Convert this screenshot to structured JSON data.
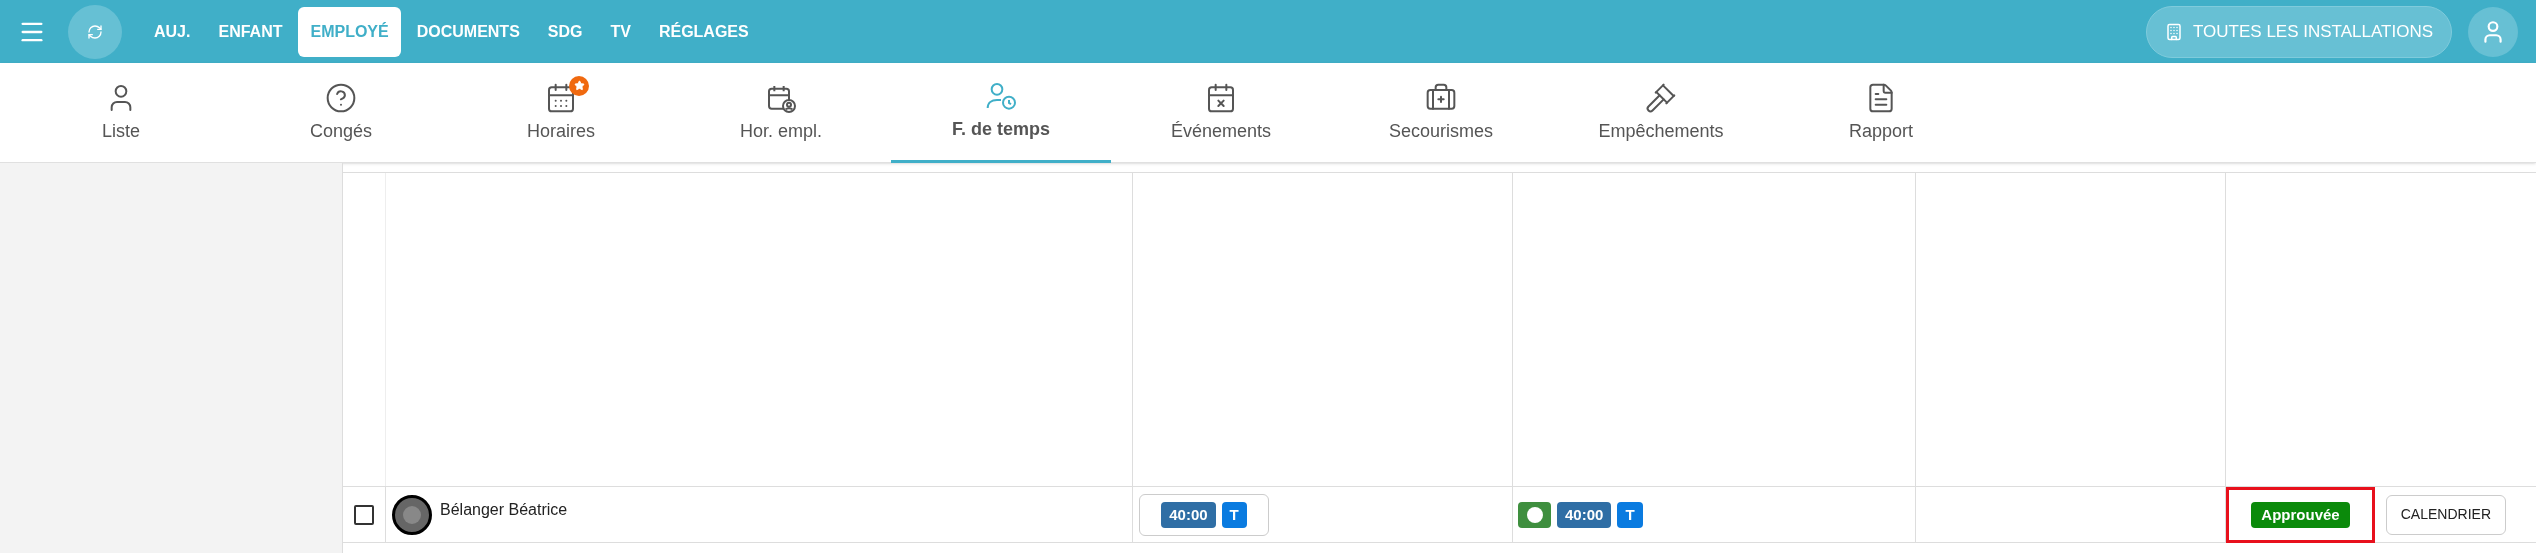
{
  "top_nav": {
    "items": [
      {
        "label": "AUJ.",
        "selected": false
      },
      {
        "label": "ENFANT",
        "selected": false
      },
      {
        "label": "EMPLOYÉ",
        "selected": true
      },
      {
        "label": "DOCUMENTS",
        "selected": false
      },
      {
        "label": "SDG",
        "selected": false
      },
      {
        "label": "TV",
        "selected": false
      },
      {
        "label": "RÉGLAGES",
        "selected": false
      }
    ],
    "facility_button": "TOUTES LES INSTALLATIONS"
  },
  "sub_tabs": [
    {
      "label": "Liste",
      "selected": false,
      "badge": false
    },
    {
      "label": "Congés",
      "selected": false,
      "badge": false
    },
    {
      "label": "Horaires",
      "selected": false,
      "badge": true
    },
    {
      "label": "Hor. empl.",
      "selected": false,
      "badge": false
    },
    {
      "label": "F. de temps",
      "selected": true,
      "badge": false
    },
    {
      "label": "Événements",
      "selected": false,
      "badge": false
    },
    {
      "label": "Secourismes",
      "selected": false,
      "badge": false
    },
    {
      "label": "Empêchements",
      "selected": false,
      "badge": false
    },
    {
      "label": "Rapport",
      "selected": false,
      "badge": false
    }
  ],
  "table": {
    "rows": [
      {
        "name": "Bélanger Béatrice",
        "checked": false,
        "planned": {
          "hours": "40:00",
          "tag": "T"
        },
        "actual": {
          "indicator": true,
          "hours": "40:00",
          "tag": "T"
        },
        "status": "Approuvée",
        "status_highlighted": true,
        "action": "CALENDRIER"
      }
    ]
  }
}
